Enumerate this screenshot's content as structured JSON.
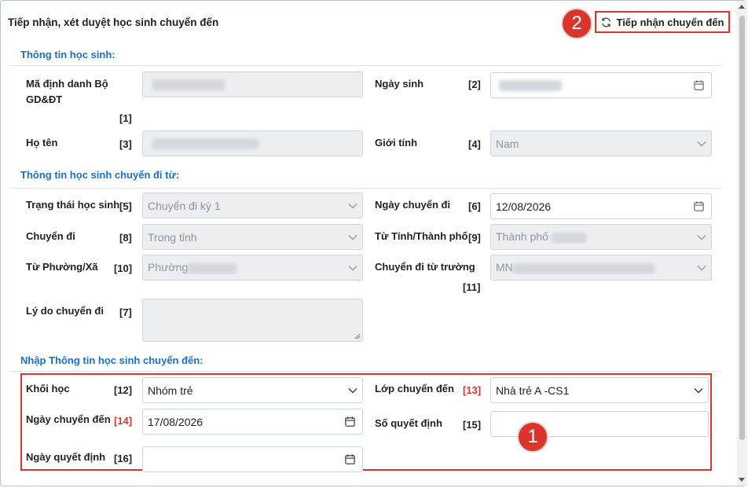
{
  "header": {
    "title": "Tiếp nhận, xét duyệt học sinh chuyển đến",
    "receive_button": "Tiếp nhận chuyển đến",
    "receive_icon": "refresh-icon"
  },
  "badges": {
    "badge_1": "1",
    "badge_2": "2"
  },
  "sections": {
    "student_info": "Thông tin học sinh:",
    "from_info": "Thông tin học sinh chuyển đi từ:",
    "to_info": "Nhập Thông tin học sinh chuyển đến:"
  },
  "student": {
    "moet_id": {
      "label": "Mã định danh Bộ GD&ĐT",
      "num": "[1]"
    },
    "dob": {
      "label": "Ngày sinh",
      "num": "[2]"
    },
    "name": {
      "label": "Họ tên",
      "num": "[3]"
    },
    "gender": {
      "label": "Giới tính",
      "num": "[4]",
      "value": "Nam"
    }
  },
  "transfer_from": {
    "status": {
      "label": "Trạng thái học sinh",
      "num": "[5]",
      "value": "Chuyển đi kỳ 1"
    },
    "departure_date": {
      "label": "Ngày chuyển đi",
      "num": "[6]",
      "value": "12/08/2026"
    },
    "transfer_type": {
      "label": "Chuyển đi",
      "num": "[8]",
      "value": "Trong tỉnh"
    },
    "province": {
      "label": "Từ Tỉnh/Thành phố",
      "num": "[9]",
      "value": "Thành phố"
    },
    "ward": {
      "label": "Từ Phường/Xã",
      "num": "[10]",
      "value": "Phường"
    },
    "school": {
      "label": "Chuyển đi từ trường",
      "num": "[11]",
      "value": "MN"
    },
    "reason": {
      "label": "Lý do chuyển đi",
      "num": "[7]"
    }
  },
  "transfer_to": {
    "grade": {
      "label": "Khối học",
      "num": "[12]",
      "value": "Nhóm trẻ"
    },
    "class": {
      "label": "Lớp chuyển đến",
      "num": "[13]",
      "value": "Nhà trẻ A -CS1"
    },
    "arrival_date": {
      "label": "Ngày chuyển đến",
      "num": "[14]",
      "value": "17/08/2026"
    },
    "decision_no": {
      "label": "Số quyết định",
      "num": "[15]",
      "value": ""
    },
    "decision_date": {
      "label": "Ngày quyết định",
      "num": "[16]",
      "value": ""
    }
  },
  "colors": {
    "accent": "#1b6fd1",
    "highlight": "#d9352c",
    "disabled": "#eceef0"
  }
}
